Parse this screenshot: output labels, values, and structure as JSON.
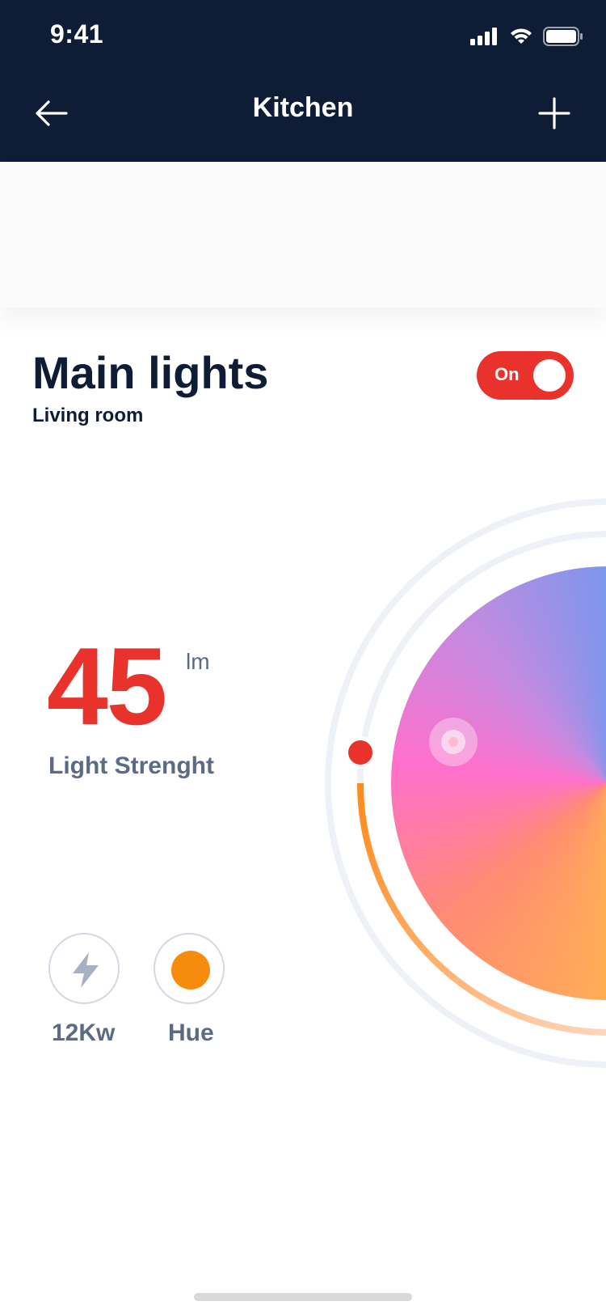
{
  "status_bar": {
    "time": "9:41"
  },
  "nav": {
    "title": "Kitchen",
    "back_icon": "arrow-left-icon",
    "add_icon": "plus-icon"
  },
  "device": {
    "name": "Main lights",
    "room": "Living room"
  },
  "toggle": {
    "label": "On",
    "state": true,
    "color": "#e8322b"
  },
  "strength": {
    "value": "45",
    "unit": "lm",
    "label": "Light Strenght"
  },
  "info": {
    "power": {
      "label": "12Kw",
      "icon": "lightning-icon"
    },
    "hue": {
      "label": "Hue",
      "color": "#f68b0e"
    }
  },
  "colors": {
    "accent": "#e8322b",
    "nav_bg": "#0f1c36",
    "secondary_text": "#5b6a85"
  }
}
